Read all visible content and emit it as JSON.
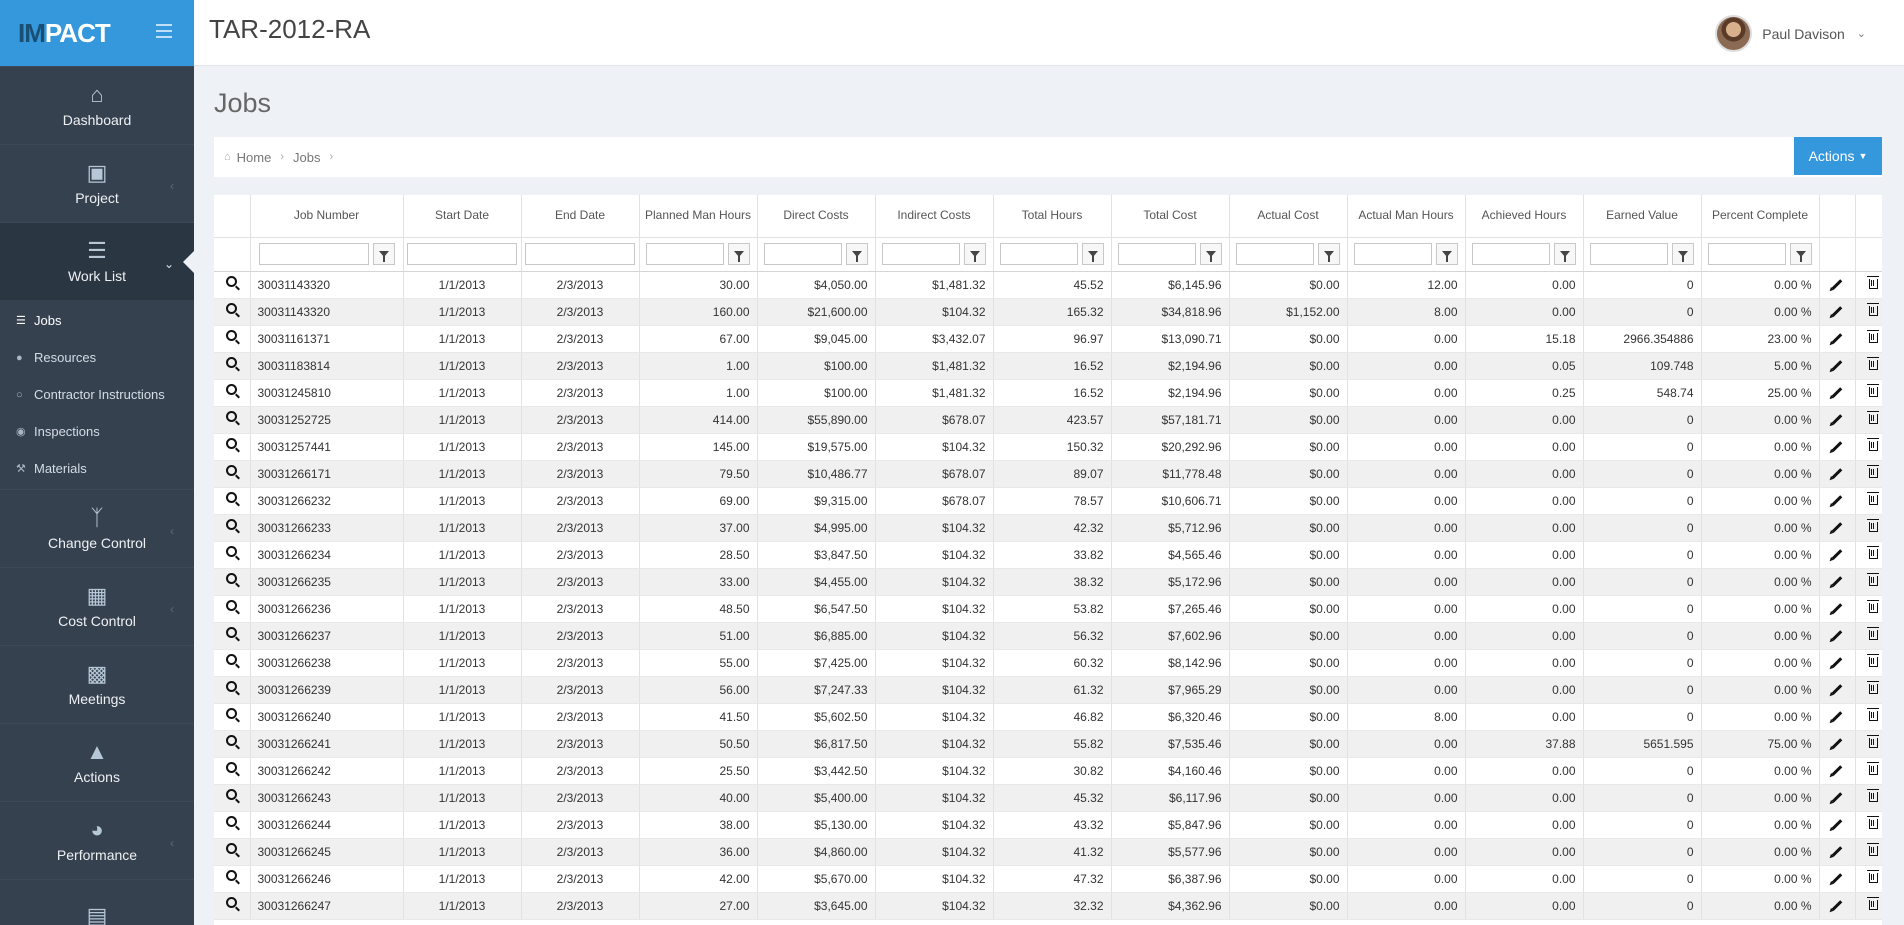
{
  "app": {
    "logo": "IMPACT",
    "title": "TAR-2012-RA"
  },
  "user": {
    "name": "Paul Davison"
  },
  "sidebar": {
    "main": [
      {
        "label": "Dashboard",
        "icon": "home-icon"
      },
      {
        "label": "Project",
        "icon": "folder-icon"
      },
      {
        "label": "Work List",
        "icon": "list-icon"
      }
    ],
    "sub": [
      {
        "label": "Jobs",
        "icon": "list-icon"
      },
      {
        "label": "Resources",
        "icon": "users-icon"
      },
      {
        "label": "Contractor Instructions",
        "icon": "comments-icon"
      },
      {
        "label": "Inspections",
        "icon": "eye-icon"
      },
      {
        "label": "Materials",
        "icon": "wrench-icon"
      }
    ],
    "lower": [
      {
        "label": "Change Control",
        "icon": "branch-icon"
      },
      {
        "label": "Cost Control",
        "icon": "money-icon"
      },
      {
        "label": "Meetings",
        "icon": "calendar-icon"
      },
      {
        "label": "Actions",
        "icon": "warning-icon"
      },
      {
        "label": "Performance",
        "icon": "dashboard-icon"
      }
    ]
  },
  "page": {
    "title": "Jobs"
  },
  "breadcrumb": {
    "home": "Home",
    "current": "Jobs"
  },
  "actions_label": "Actions",
  "table": {
    "columns": [
      "Job Number",
      "Start Date",
      "End Date",
      "Planned Man Hours",
      "Direct Costs",
      "Indirect Costs",
      "Total Hours",
      "Total Cost",
      "Actual Cost",
      "Actual Man Hours",
      "Achieved Hours",
      "Earned Value",
      "Percent Complete"
    ],
    "rows": [
      [
        "30031143320",
        "1/1/2013",
        "2/3/2013",
        "30.00",
        "$4,050.00",
        "$1,481.32",
        "45.52",
        "$6,145.96",
        "$0.00",
        "12.00",
        "0.00",
        "0",
        "0.00 %"
      ],
      [
        "30031143320",
        "1/1/2013",
        "2/3/2013",
        "160.00",
        "$21,600.00",
        "$104.32",
        "165.32",
        "$34,818.96",
        "$1,152.00",
        "8.00",
        "0.00",
        "0",
        "0.00 %"
      ],
      [
        "30031161371",
        "1/1/2013",
        "2/3/2013",
        "67.00",
        "$9,045.00",
        "$3,432.07",
        "96.97",
        "$13,090.71",
        "$0.00",
        "0.00",
        "15.18",
        "2966.354886",
        "23.00 %"
      ],
      [
        "30031183814",
        "1/1/2013",
        "2/3/2013",
        "1.00",
        "$100.00",
        "$1,481.32",
        "16.52",
        "$2,194.96",
        "$0.00",
        "0.00",
        "0.05",
        "109.748",
        "5.00 %"
      ],
      [
        "30031245810",
        "1/1/2013",
        "2/3/2013",
        "1.00",
        "$100.00",
        "$1,481.32",
        "16.52",
        "$2,194.96",
        "$0.00",
        "0.00",
        "0.25",
        "548.74",
        "25.00 %"
      ],
      [
        "30031252725",
        "1/1/2013",
        "2/3/2013",
        "414.00",
        "$55,890.00",
        "$678.07",
        "423.57",
        "$57,181.71",
        "$0.00",
        "0.00",
        "0.00",
        "0",
        "0.00 %"
      ],
      [
        "30031257441",
        "1/1/2013",
        "2/3/2013",
        "145.00",
        "$19,575.00",
        "$104.32",
        "150.32",
        "$20,292.96",
        "$0.00",
        "0.00",
        "0.00",
        "0",
        "0.00 %"
      ],
      [
        "30031266171",
        "1/1/2013",
        "2/3/2013",
        "79.50",
        "$10,486.77",
        "$678.07",
        "89.07",
        "$11,778.48",
        "$0.00",
        "0.00",
        "0.00",
        "0",
        "0.00 %"
      ],
      [
        "30031266232",
        "1/1/2013",
        "2/3/2013",
        "69.00",
        "$9,315.00",
        "$678.07",
        "78.57",
        "$10,606.71",
        "$0.00",
        "0.00",
        "0.00",
        "0",
        "0.00 %"
      ],
      [
        "30031266233",
        "1/1/2013",
        "2/3/2013",
        "37.00",
        "$4,995.00",
        "$104.32",
        "42.32",
        "$5,712.96",
        "$0.00",
        "0.00",
        "0.00",
        "0",
        "0.00 %"
      ],
      [
        "30031266234",
        "1/1/2013",
        "2/3/2013",
        "28.50",
        "$3,847.50",
        "$104.32",
        "33.82",
        "$4,565.46",
        "$0.00",
        "0.00",
        "0.00",
        "0",
        "0.00 %"
      ],
      [
        "30031266235",
        "1/1/2013",
        "2/3/2013",
        "33.00",
        "$4,455.00",
        "$104.32",
        "38.32",
        "$5,172.96",
        "$0.00",
        "0.00",
        "0.00",
        "0",
        "0.00 %"
      ],
      [
        "30031266236",
        "1/1/2013",
        "2/3/2013",
        "48.50",
        "$6,547.50",
        "$104.32",
        "53.82",
        "$7,265.46",
        "$0.00",
        "0.00",
        "0.00",
        "0",
        "0.00 %"
      ],
      [
        "30031266237",
        "1/1/2013",
        "2/3/2013",
        "51.00",
        "$6,885.00",
        "$104.32",
        "56.32",
        "$7,602.96",
        "$0.00",
        "0.00",
        "0.00",
        "0",
        "0.00 %"
      ],
      [
        "30031266238",
        "1/1/2013",
        "2/3/2013",
        "55.00",
        "$7,425.00",
        "$104.32",
        "60.32",
        "$8,142.96",
        "$0.00",
        "0.00",
        "0.00",
        "0",
        "0.00 %"
      ],
      [
        "30031266239",
        "1/1/2013",
        "2/3/2013",
        "56.00",
        "$7,247.33",
        "$104.32",
        "61.32",
        "$7,965.29",
        "$0.00",
        "0.00",
        "0.00",
        "0",
        "0.00 %"
      ],
      [
        "30031266240",
        "1/1/2013",
        "2/3/2013",
        "41.50",
        "$5,602.50",
        "$104.32",
        "46.82",
        "$6,320.46",
        "$0.00",
        "8.00",
        "0.00",
        "0",
        "0.00 %"
      ],
      [
        "30031266241",
        "1/1/2013",
        "2/3/2013",
        "50.50",
        "$6,817.50",
        "$104.32",
        "55.82",
        "$7,535.46",
        "$0.00",
        "0.00",
        "37.88",
        "5651.595",
        "75.00 %"
      ],
      [
        "30031266242",
        "1/1/2013",
        "2/3/2013",
        "25.50",
        "$3,442.50",
        "$104.32",
        "30.82",
        "$4,160.46",
        "$0.00",
        "0.00",
        "0.00",
        "0",
        "0.00 %"
      ],
      [
        "30031266243",
        "1/1/2013",
        "2/3/2013",
        "40.00",
        "$5,400.00",
        "$104.32",
        "45.32",
        "$6,117.96",
        "$0.00",
        "0.00",
        "0.00",
        "0",
        "0.00 %"
      ],
      [
        "30031266244",
        "1/1/2013",
        "2/3/2013",
        "38.00",
        "$5,130.00",
        "$104.32",
        "43.32",
        "$5,847.96",
        "$0.00",
        "0.00",
        "0.00",
        "0",
        "0.00 %"
      ],
      [
        "30031266245",
        "1/1/2013",
        "2/3/2013",
        "36.00",
        "$4,860.00",
        "$104.32",
        "41.32",
        "$5,577.96",
        "$0.00",
        "0.00",
        "0.00",
        "0",
        "0.00 %"
      ],
      [
        "30031266246",
        "1/1/2013",
        "2/3/2013",
        "42.00",
        "$5,670.00",
        "$104.32",
        "47.32",
        "$6,387.96",
        "$0.00",
        "0.00",
        "0.00",
        "0",
        "0.00 %"
      ],
      [
        "30031266247",
        "1/1/2013",
        "2/3/2013",
        "27.00",
        "$3,645.00",
        "$104.32",
        "32.32",
        "$4,362.96",
        "$0.00",
        "0.00",
        "0.00",
        "0",
        "0.00 %"
      ]
    ]
  },
  "colors": {
    "brand": "#3598dc",
    "sidebar": "#364150",
    "sidebar_active": "#2b3643"
  }
}
